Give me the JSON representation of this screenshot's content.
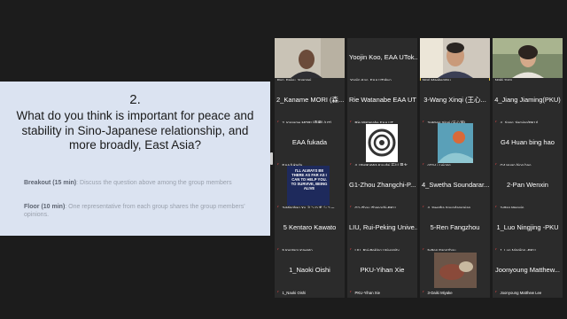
{
  "slide": {
    "number": "2.",
    "question": "What do you think is important for peace and stability in Sino-Japanese relationship, and more broadly, East Asia?",
    "breakout_label": "Breakout (15 min)",
    "breakout_text": ": Discuss the question above among the group members",
    "floor_label": "Floor (10 min)",
    "floor_text": ": One representative from each group shares the group members' opinions."
  },
  "participants": [
    {
      "name": "",
      "label": "Bun, Feiyu, Yuanpei",
      "muted": false
    },
    {
      "name": "Yoojin Koo, EAA UTok...",
      "label": "Yoojin Koo, EAA UTokyo",
      "muted": false
    },
    {
      "name": "",
      "label": "Mori Maekemtsu",
      "muted": false
    },
    {
      "name": "",
      "label": "Maki Sato",
      "muted": false
    },
    {
      "name": "2_Kaname MORI (森...",
      "label": "2_Kaname MORI (森要) (UT)",
      "muted": true
    },
    {
      "name": "Rie Watanabe EAA UT",
      "label": "Rie Watanabe EAA UT",
      "muted": true
    },
    {
      "name": "3-Wang Xinqi (王心...",
      "label": "3-Wang Xinqi (王心琦)",
      "muted": true
    },
    {
      "name": "4_Jiang Jiaming(PKU)",
      "label": "4_Jiang Jiaming(PKU)",
      "muted": true
    },
    {
      "name": "EAA fukada",
      "label": "EAA fukada",
      "muted": true
    },
    {
      "name": "",
      "label": "4_ISHIKAWA Koudai 石川 晃大",
      "muted": true
    },
    {
      "name": "",
      "label": "g23-Li Leiong",
      "muted": true
    },
    {
      "name": "G4 Huan bing hao",
      "label": "G4 Huan bing hao",
      "muted": true
    },
    {
      "name": "",
      "label": "3-Minghao Xu ミンハオ シュー",
      "muted": true
    },
    {
      "name": "G1-Zhou Zhangchi-P...",
      "label": "G1-Zhou Zhangchi-PKU",
      "muted": true
    },
    {
      "name": "4_Swetha Soundarar...",
      "label": "4_Swetha Soundararajan",
      "muted": true
    },
    {
      "name": "2-Pan Wenxin",
      "label": "2-Pan Wenxin",
      "muted": true
    },
    {
      "name": "5 Kentaro Kawato",
      "label": "5 Kentaro Kawato",
      "muted": true
    },
    {
      "name": "LIU, Rui-Peking Unive...",
      "label": "LIU, Rui-Peking University",
      "muted": true
    },
    {
      "name": "5-Ren Fangzhou",
      "label": "5-Ren Fangzhou",
      "muted": true
    },
    {
      "name": "1_Luo Ningjing -PKU",
      "label": "1_Luo Ningjing -PKU",
      "muted": true
    },
    {
      "name": "1_Naoki Oishi",
      "label": "1_Naoki Oishi",
      "muted": true
    },
    {
      "name": "PKU-Yihan Xie",
      "label": "PKU-Yihan Xie",
      "muted": true
    },
    {
      "name": "",
      "label": "3-Daiki Miyake",
      "muted": true
    },
    {
      "name": "Joonyoung Matthew...",
      "label": "Joonyoung Matthew Lee",
      "muted": true
    }
  ],
  "video_tile_text": "I'LL ALWAYS BE THERE AS FAR AS I CAN TO HELP YOU. TO SURVIVE, BEING ALIVE"
}
